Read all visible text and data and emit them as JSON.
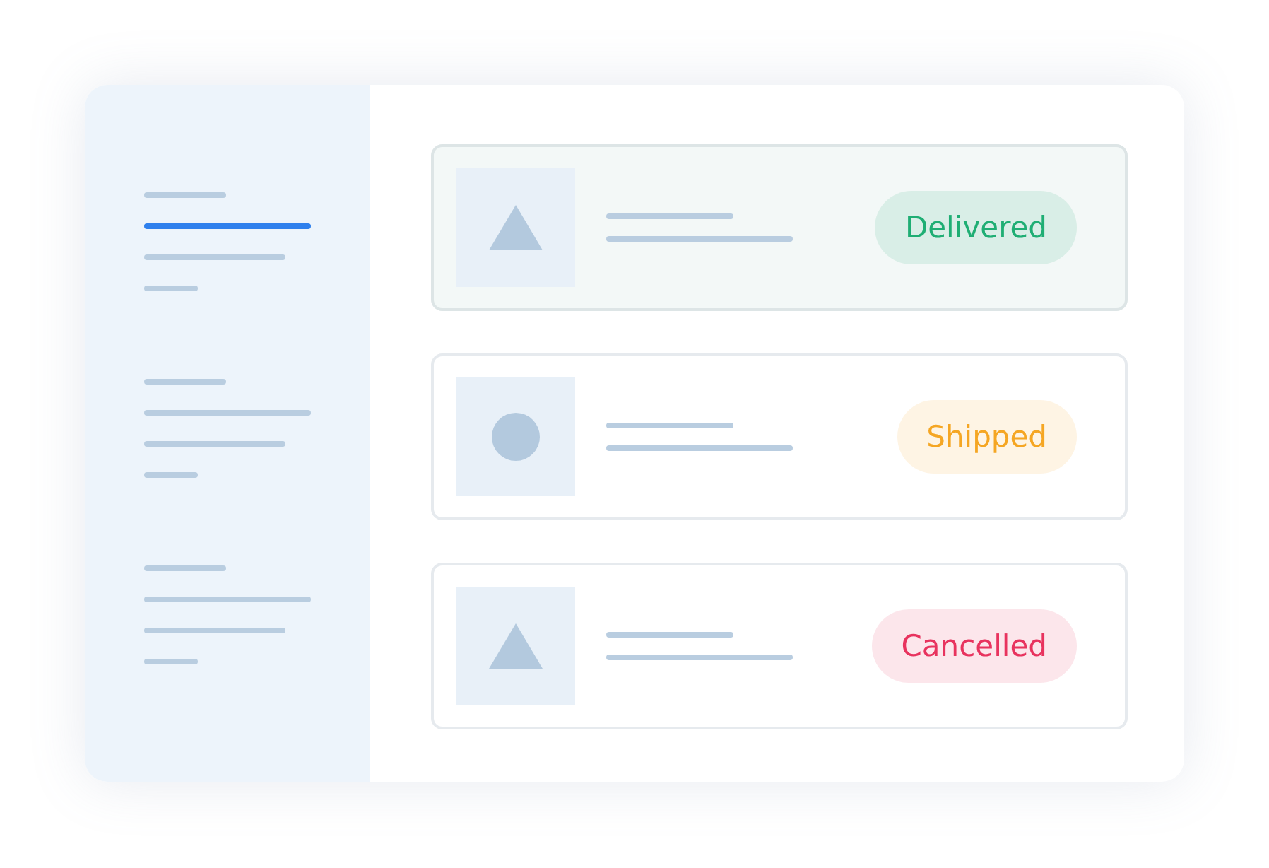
{
  "sidebar": {
    "groups": [
      {
        "items": [
          {
            "selected": false
          },
          {
            "selected": true
          },
          {
            "selected": false
          },
          {
            "selected": false
          }
        ]
      },
      {
        "items": [
          {
            "selected": false
          },
          {
            "selected": false
          },
          {
            "selected": false
          },
          {
            "selected": false
          }
        ]
      },
      {
        "items": [
          {
            "selected": false
          },
          {
            "selected": false
          },
          {
            "selected": false
          },
          {
            "selected": false
          }
        ]
      }
    ]
  },
  "orders": [
    {
      "kind": "triangle",
      "selected": true,
      "status": "Delivered",
      "color": "#1fae74"
    },
    {
      "kind": "circle",
      "selected": false,
      "status": "Shipped",
      "color": "#f5a623"
    },
    {
      "kind": "triangle",
      "selected": false,
      "status": "Cancelled",
      "color": "#e8335e"
    }
  ]
}
